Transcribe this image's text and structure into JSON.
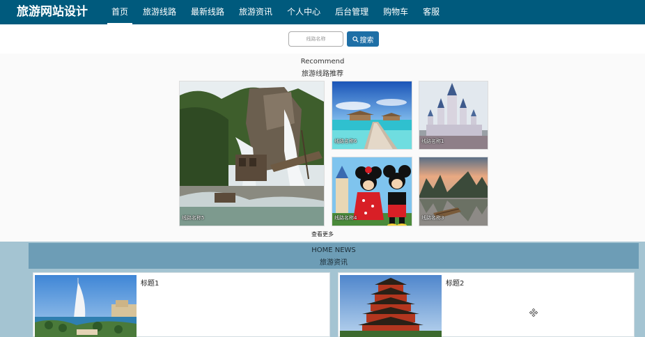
{
  "brand": "旅游网站设计",
  "nav": {
    "items": [
      {
        "label": "首页",
        "active": true
      },
      {
        "label": "旅游线路"
      },
      {
        "label": "最新线路"
      },
      {
        "label": "旅游资讯"
      },
      {
        "label": "个人中心"
      },
      {
        "label": "后台管理"
      },
      {
        "label": "购物车"
      },
      {
        "label": "客服"
      }
    ]
  },
  "search": {
    "placeholder": "线路名称",
    "button_label": "搜索"
  },
  "recommend": {
    "title_en": "Recommend",
    "title_cn": "旅游线路推荐",
    "cards": [
      {
        "label": "线路名称5"
      },
      {
        "label": "线路名称6"
      },
      {
        "label": "线路名称1"
      },
      {
        "label": "线路名称4"
      },
      {
        "label": "线路名称3"
      }
    ],
    "more_label": "查看更多"
  },
  "news": {
    "title_en": "HOME NEWS",
    "title_cn": "旅游资讯",
    "items": [
      {
        "title": "标题1"
      },
      {
        "title": "标题2"
      }
    ]
  },
  "colors": {
    "nav_bg": "#005a7d",
    "button_bg": "#1e6fa6",
    "news_bg": "#a4c4d2",
    "news_header_bg": "#6d9db6"
  }
}
